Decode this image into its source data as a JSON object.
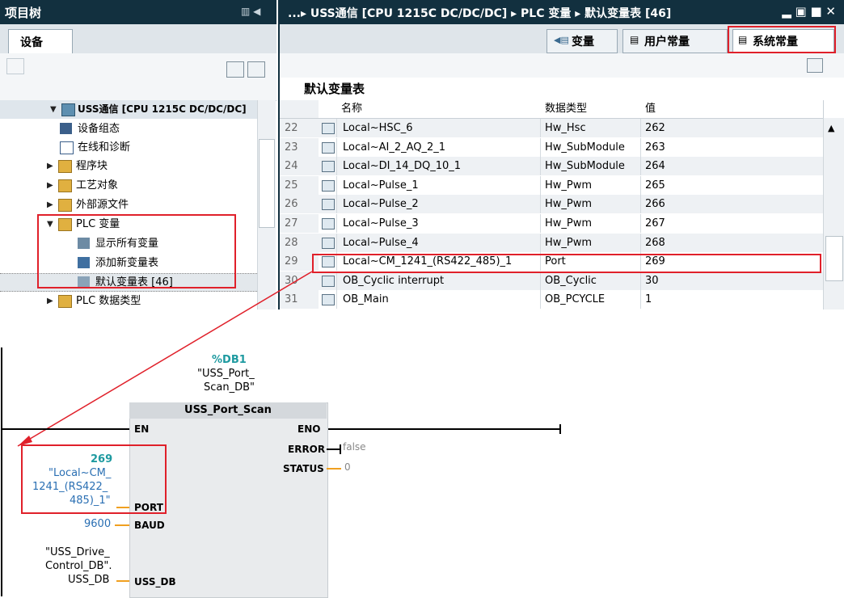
{
  "tree": {
    "title": "项目树",
    "controls": "▥ ◀",
    "tab": "设备",
    "items": [
      {
        "label": "USS通信 [CPU 1215C DC/DC/DC]",
        "arrow": "▼",
        "icon": "cpu-icon"
      },
      {
        "label": "设备组态",
        "icon": "device-config-icon"
      },
      {
        "label": "在线和诊断",
        "icon": "online-diagnostics-icon"
      },
      {
        "label": "程序块",
        "arrow": "▶",
        "icon": "folder-icon"
      },
      {
        "label": "工艺对象",
        "arrow": "▶",
        "icon": "folder-icon"
      },
      {
        "label": "外部源文件",
        "arrow": "▶",
        "icon": "folder-icon"
      },
      {
        "label": "PLC 变量",
        "arrow": "▼",
        "icon": "folder-icon"
      },
      {
        "label": "显示所有变量",
        "icon": "show-all-tags-icon"
      },
      {
        "label": "添加新变量表",
        "icon": "add-tag-table-icon"
      },
      {
        "label": "默认变量表 [46]",
        "icon": "tag-table-icon"
      },
      {
        "label": "PLC 数据类型",
        "arrow": "▶",
        "icon": "folder-icon"
      }
    ]
  },
  "window": {
    "breadcrumb": "...▸ USS通信 [CPU 1215C DC/DC/DC] ▸ PLC 变量 ▸ 默认变量表 [46]",
    "controls": "▂ ▣ ■ ✕",
    "tabs": [
      "变量",
      "用户常量",
      "系统常量"
    ],
    "table_title": "默认变量表",
    "columns": [
      "名称",
      "数据类型",
      "值"
    ],
    "rows": [
      {
        "no": "22",
        "name": "Local~HSC_6",
        "type": "Hw_Hsc",
        "value": "262"
      },
      {
        "no": "23",
        "name": "Local~AI_2_AQ_2_1",
        "type": "Hw_SubModule",
        "value": "263"
      },
      {
        "no": "24",
        "name": "Local~DI_14_DQ_10_1",
        "type": "Hw_SubModule",
        "value": "264"
      },
      {
        "no": "25",
        "name": "Local~Pulse_1",
        "type": "Hw_Pwm",
        "value": "265"
      },
      {
        "no": "26",
        "name": "Local~Pulse_2",
        "type": "Hw_Pwm",
        "value": "266"
      },
      {
        "no": "27",
        "name": "Local~Pulse_3",
        "type": "Hw_Pwm",
        "value": "267"
      },
      {
        "no": "28",
        "name": "Local~Pulse_4",
        "type": "Hw_Pwm",
        "value": "268"
      },
      {
        "no": "29",
        "name": "Local~CM_1241_(RS422_485)_1",
        "type": "Port",
        "value": "269"
      },
      {
        "no": "30",
        "name": "OB_Cyclic interrupt",
        "type": "OB_Cyclic",
        "value": "30"
      },
      {
        "no": "31",
        "name": "OB_Main",
        "type": "OB_PCYCLE",
        "value": "1"
      }
    ]
  },
  "lad": {
    "db_address": "%DB1",
    "db_name_1": "\"USS_Port_",
    "db_name_2": "Scan_DB\"",
    "block": "USS_Port_Scan",
    "pins": {
      "en": "EN",
      "eno": "ENO",
      "error": "ERROR",
      "status": "STATUS",
      "port": "PORT",
      "baud": "BAUD",
      "uss_db": "USS_DB"
    },
    "error_val": "false",
    "status_val": "0",
    "port_value": "269",
    "port_tag_1": "\"Local~CM_",
    "port_tag_2": "1241_(RS422_",
    "port_tag_3": "485)_1\"",
    "baud_val": "9600",
    "ussdb_1": "\"USS_Drive_",
    "ussdb_2": "Control_DB\".",
    "ussdb_3": "USS_DB"
  },
  "colors": {
    "title_bar": "#12303f",
    "highlight": "#e0202a",
    "teal": "#1e9aa0",
    "link_blue": "#2a6fb3"
  }
}
